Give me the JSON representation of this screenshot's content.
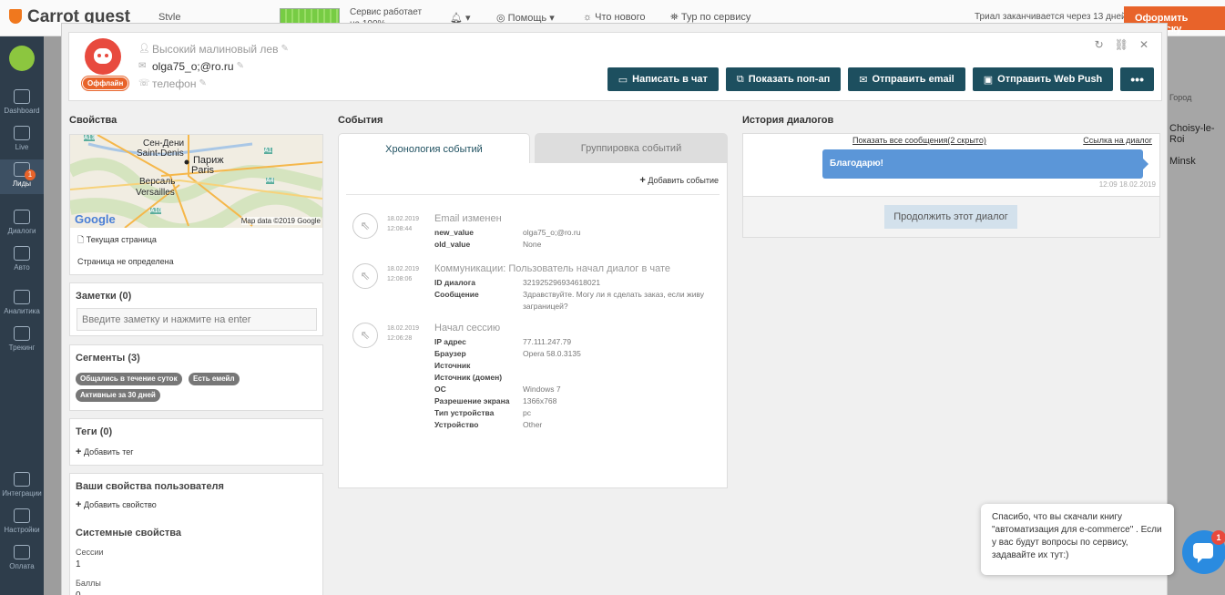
{
  "app": {
    "brand": "Carrot quest",
    "project": "Stvle",
    "service_status": "Сервис работает на 100%",
    "help": "Помощь",
    "whats_new": "Что нового",
    "tour": "Тур по сервису",
    "trial": "Триал заканчивается через 13 дней",
    "subscribe": "Оформить подписку",
    "sidebar": [
      {
        "label": "Dashboard"
      },
      {
        "label": "Live"
      },
      {
        "label": "Лиды"
      },
      {
        "label": "Диалоги"
      },
      {
        "label": "Авто"
      },
      {
        "label": "Аналитика"
      },
      {
        "label": "Трекинг"
      },
      {
        "label": "Интеграции"
      },
      {
        "label": "Настройки"
      },
      {
        "label": "Оплата"
      }
    ],
    "dialogs_badge": "1",
    "right_col": {
      "header": "Город",
      "rows": [
        "Choisy-le-Roi",
        "Minsk"
      ]
    }
  },
  "lead": {
    "status": "Оффлайн",
    "name": "Высокий малиновый лев",
    "email": "olga75_o;@ro.ru",
    "phone": "телефон"
  },
  "actions": {
    "chat": "Написать в чат",
    "popup": "Показать поп-ап",
    "email": "Отправить email",
    "webpush": "Отправить Web Push",
    "more": "•••"
  },
  "properties": {
    "title": "Свойства",
    "map": {
      "labels": [
        "Сен-Дени",
        "Saint-Denis",
        "Париж",
        "Paris",
        "Версаль",
        "Versailles"
      ],
      "roads": [
        "A13",
        "A1",
        "A4",
        "A10"
      ],
      "google": "Google",
      "credit": "Map data ©2019 Google"
    },
    "current_page_label": "Текущая страница",
    "current_page_value": "Страница не определена"
  },
  "notes": {
    "title": "Заметки (0)",
    "placeholder": "Введите заметку и нажмите на enter"
  },
  "segments": {
    "title": "Сегменты (3)",
    "items": [
      "Общались в течение суток",
      "Есть емейл",
      "Активные за 30 дней"
    ]
  },
  "tags": {
    "title": "Теги (0)",
    "add": "Добавить тег"
  },
  "user_props": {
    "title": "Ваши свойства пользователя",
    "add": "Добавить свойство",
    "system_title": "Системные свойства",
    "sessions_label": "Сессии",
    "sessions_value": "1",
    "points_label": "Баллы",
    "points_value": "0"
  },
  "events": {
    "title": "События",
    "tabs": [
      "Хронология событий",
      "Группировка событий"
    ],
    "add": "Добавить событие",
    "items": [
      {
        "date": "18.02.2019",
        "time": "12:08:44",
        "title": "Email изменен",
        "rows": [
          [
            "new_value",
            "olga75_o;@ro.ru"
          ],
          [
            "old_value",
            "None"
          ]
        ]
      },
      {
        "date": "18.02.2019",
        "time": "12:08:06",
        "title": "Коммуникации: Пользователь начал диалог в чате",
        "rows": [
          [
            "ID диалога",
            "321925296934618021"
          ],
          [
            "Сообщение",
            "Здравствуйте. Могу ли я сделать заказ, если живу заграницей?"
          ]
        ]
      },
      {
        "date": "18.02.2019",
        "time": "12:06:28",
        "title": "Начал сессию",
        "rows": [
          [
            "IP адрес",
            "77.111.247.79"
          ],
          [
            "Браузер",
            "Opera 58.0.3135"
          ],
          [
            "Источник",
            ""
          ],
          [
            "Источник (домен)",
            ""
          ],
          [
            "ОС",
            "Windows 7"
          ],
          [
            "Разрешение экрана",
            "1366x768"
          ],
          [
            "Тип устройства",
            "pc"
          ],
          [
            "Устройство",
            "Other"
          ]
        ]
      }
    ]
  },
  "dialogs": {
    "title": "История диалогов",
    "show_all": "Показать все сообщения(2 скрыто)",
    "link": "Ссылка на диалог",
    "message": "Благодарю!",
    "time": "12:09 18.02.2019",
    "continue": "Продолжить этот диалог"
  },
  "chat_widget": {
    "text": "Спасибо, что вы скачали книгу \"автоматизация для e-commerce\" . Если у вас будут вопросы по сервису, задавайте их тут:)",
    "count": "1"
  },
  "colors": {
    "primary": "#1d4f5f",
    "accent": "#e8632a",
    "bubble": "#5b96d8",
    "widget": "#2a8be0"
  }
}
